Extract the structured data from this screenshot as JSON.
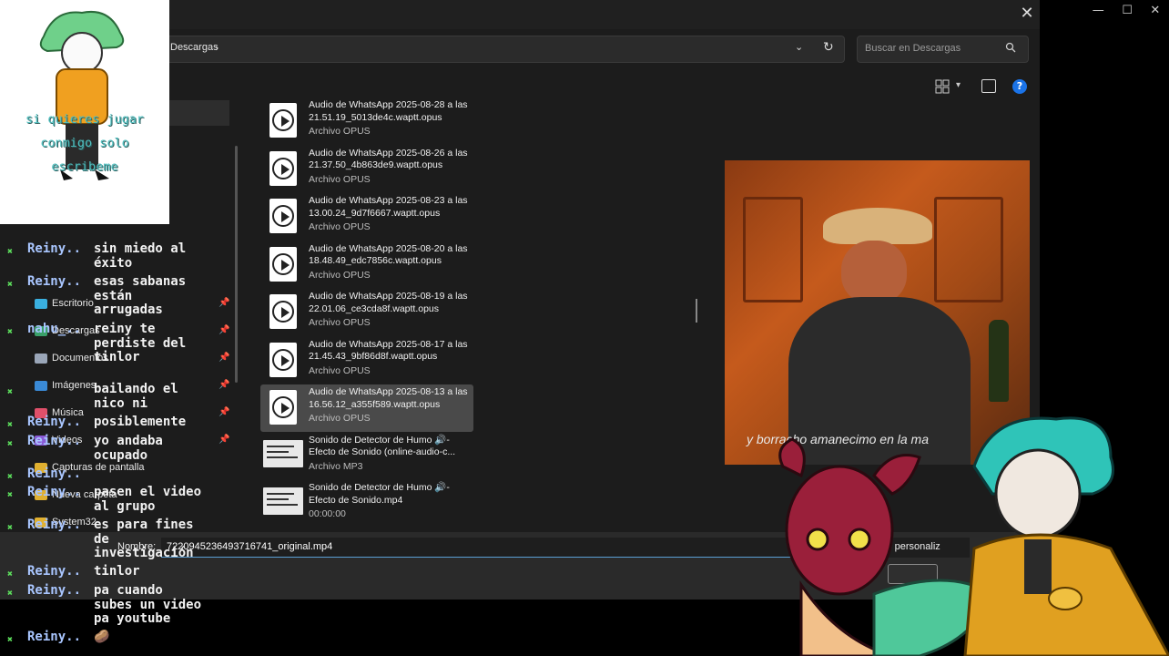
{
  "window": {
    "close_glyph": "✕",
    "controls": [
      "—",
      "☐",
      "✕"
    ]
  },
  "address": {
    "breadcrumb": "Descargas",
    "chevron": "›",
    "dropdown_glyph": "⌄",
    "refresh_glyph": "↻"
  },
  "search": {
    "placeholder": "Buscar en Descargas",
    "icon": "search-icon"
  },
  "toolbar": {
    "view_icon": "view-options-icon",
    "view_dd": "▾",
    "help_glyph": "?"
  },
  "nav": {
    "items": [
      {
        "label": "Escritorio",
        "icon": "desktop-icon",
        "color": "#3ab0e0"
      },
      {
        "label": "Descargas",
        "icon": "download-icon",
        "color": "#3aa06a"
      },
      {
        "label": "Documentos",
        "icon": "document-icon",
        "color": "#9aa6b8"
      },
      {
        "label": "Imágenes",
        "icon": "image-icon",
        "color": "#3a8ad6"
      },
      {
        "label": "Música",
        "icon": "music-icon",
        "color": "#e0506a"
      },
      {
        "label": "Videos",
        "icon": "video-icon",
        "color": "#8a5ad6"
      },
      {
        "label": "Capturas de pantalla",
        "icon": "folder-icon",
        "color": "#e0b030"
      },
      {
        "label": "Nueva carpeta",
        "icon": "folder-icon",
        "color": "#e0b030"
      },
      {
        "label": "System32",
        "icon": "folder-icon",
        "color": "#e0b030"
      }
    ],
    "pin_glyph": "📌"
  },
  "files": [
    {
      "name": "Audio de WhatsApp 2025-08-28 a las 21.51.19_5013de4c.waptt.opus",
      "type": "Archivo OPUS",
      "kind": "audio"
    },
    {
      "name": "Audio de WhatsApp 2025-08-26 a las 21.37.50_4b863de9.waptt.opus",
      "type": "Archivo OPUS",
      "kind": "audio"
    },
    {
      "name": "Audio de WhatsApp 2025-08-23 a las 13.00.24_9d7f6667.waptt.opus",
      "type": "Archivo OPUS",
      "kind": "audio"
    },
    {
      "name": "Audio de WhatsApp 2025-08-20 a las 18.48.49_edc7856c.waptt.opus",
      "type": "Archivo OPUS",
      "kind": "audio"
    },
    {
      "name": "Audio de WhatsApp 2025-08-19 a las 22.01.06_ce3cda8f.waptt.opus",
      "type": "Archivo OPUS",
      "kind": "audio"
    },
    {
      "name": "Audio de WhatsApp 2025-08-17 a las 21.45.43_9bf86d8f.waptt.opus",
      "type": "Archivo OPUS",
      "kind": "audio"
    },
    {
      "name": "Audio de WhatsApp 2025-08-13 a las 16.56.12_a355f589.waptt.opus",
      "type": "Archivo OPUS",
      "kind": "audio",
      "selected": true
    },
    {
      "name": "Sonido de Detector de Humo 🔊- Efecto de Sonido (online-audio-c...",
      "type": "Archivo MP3",
      "kind": "thumb"
    },
    {
      "name": "Sonido de Detector de Humo 🔊- Efecto de Sonido.mp4",
      "type": "00:00:00",
      "kind": "thumb"
    }
  ],
  "preview": {
    "subtitle": "y borracho amanecimo en la ma"
  },
  "footer": {
    "name_label": "Nombre:",
    "name_value": "7220945236493716741_original.mp4",
    "type_value": "ivos personaliz"
  },
  "overlay": {
    "pngtuber_text": "si quieres jugar\nconmigo solo\nescribeme"
  },
  "chat": [
    {
      "user": "Reiny..",
      "msg": "sin miedo al\néxito"
    },
    {
      "user": "Reiny..",
      "msg": "esas sabanas\nestán\narrugadas"
    },
    {
      "user": "nahu_..",
      "msg": "reiny te\nperdiste del\ntinlor"
    },
    {
      "user": "",
      "msg": "bailando el\nnico ni"
    },
    {
      "user": "Reiny..",
      "msg": "posiblemente"
    },
    {
      "user": "Reiny..",
      "msg": "yo andaba\nocupado"
    },
    {
      "user": "Reiny..",
      "msg": ""
    },
    {
      "user": "Reiny..",
      "msg": "pasen el video\nal grupo"
    },
    {
      "user": "Reiny..",
      "msg": "es para fines\nde\ninvestigación"
    },
    {
      "user": "Reiny..",
      "msg": "tinlor"
    },
    {
      "user": "Reiny..",
      "msg": "pa cuando\nsubes un video\npa youtube"
    },
    {
      "user": "Reiny..",
      "msg": "🥔"
    }
  ]
}
